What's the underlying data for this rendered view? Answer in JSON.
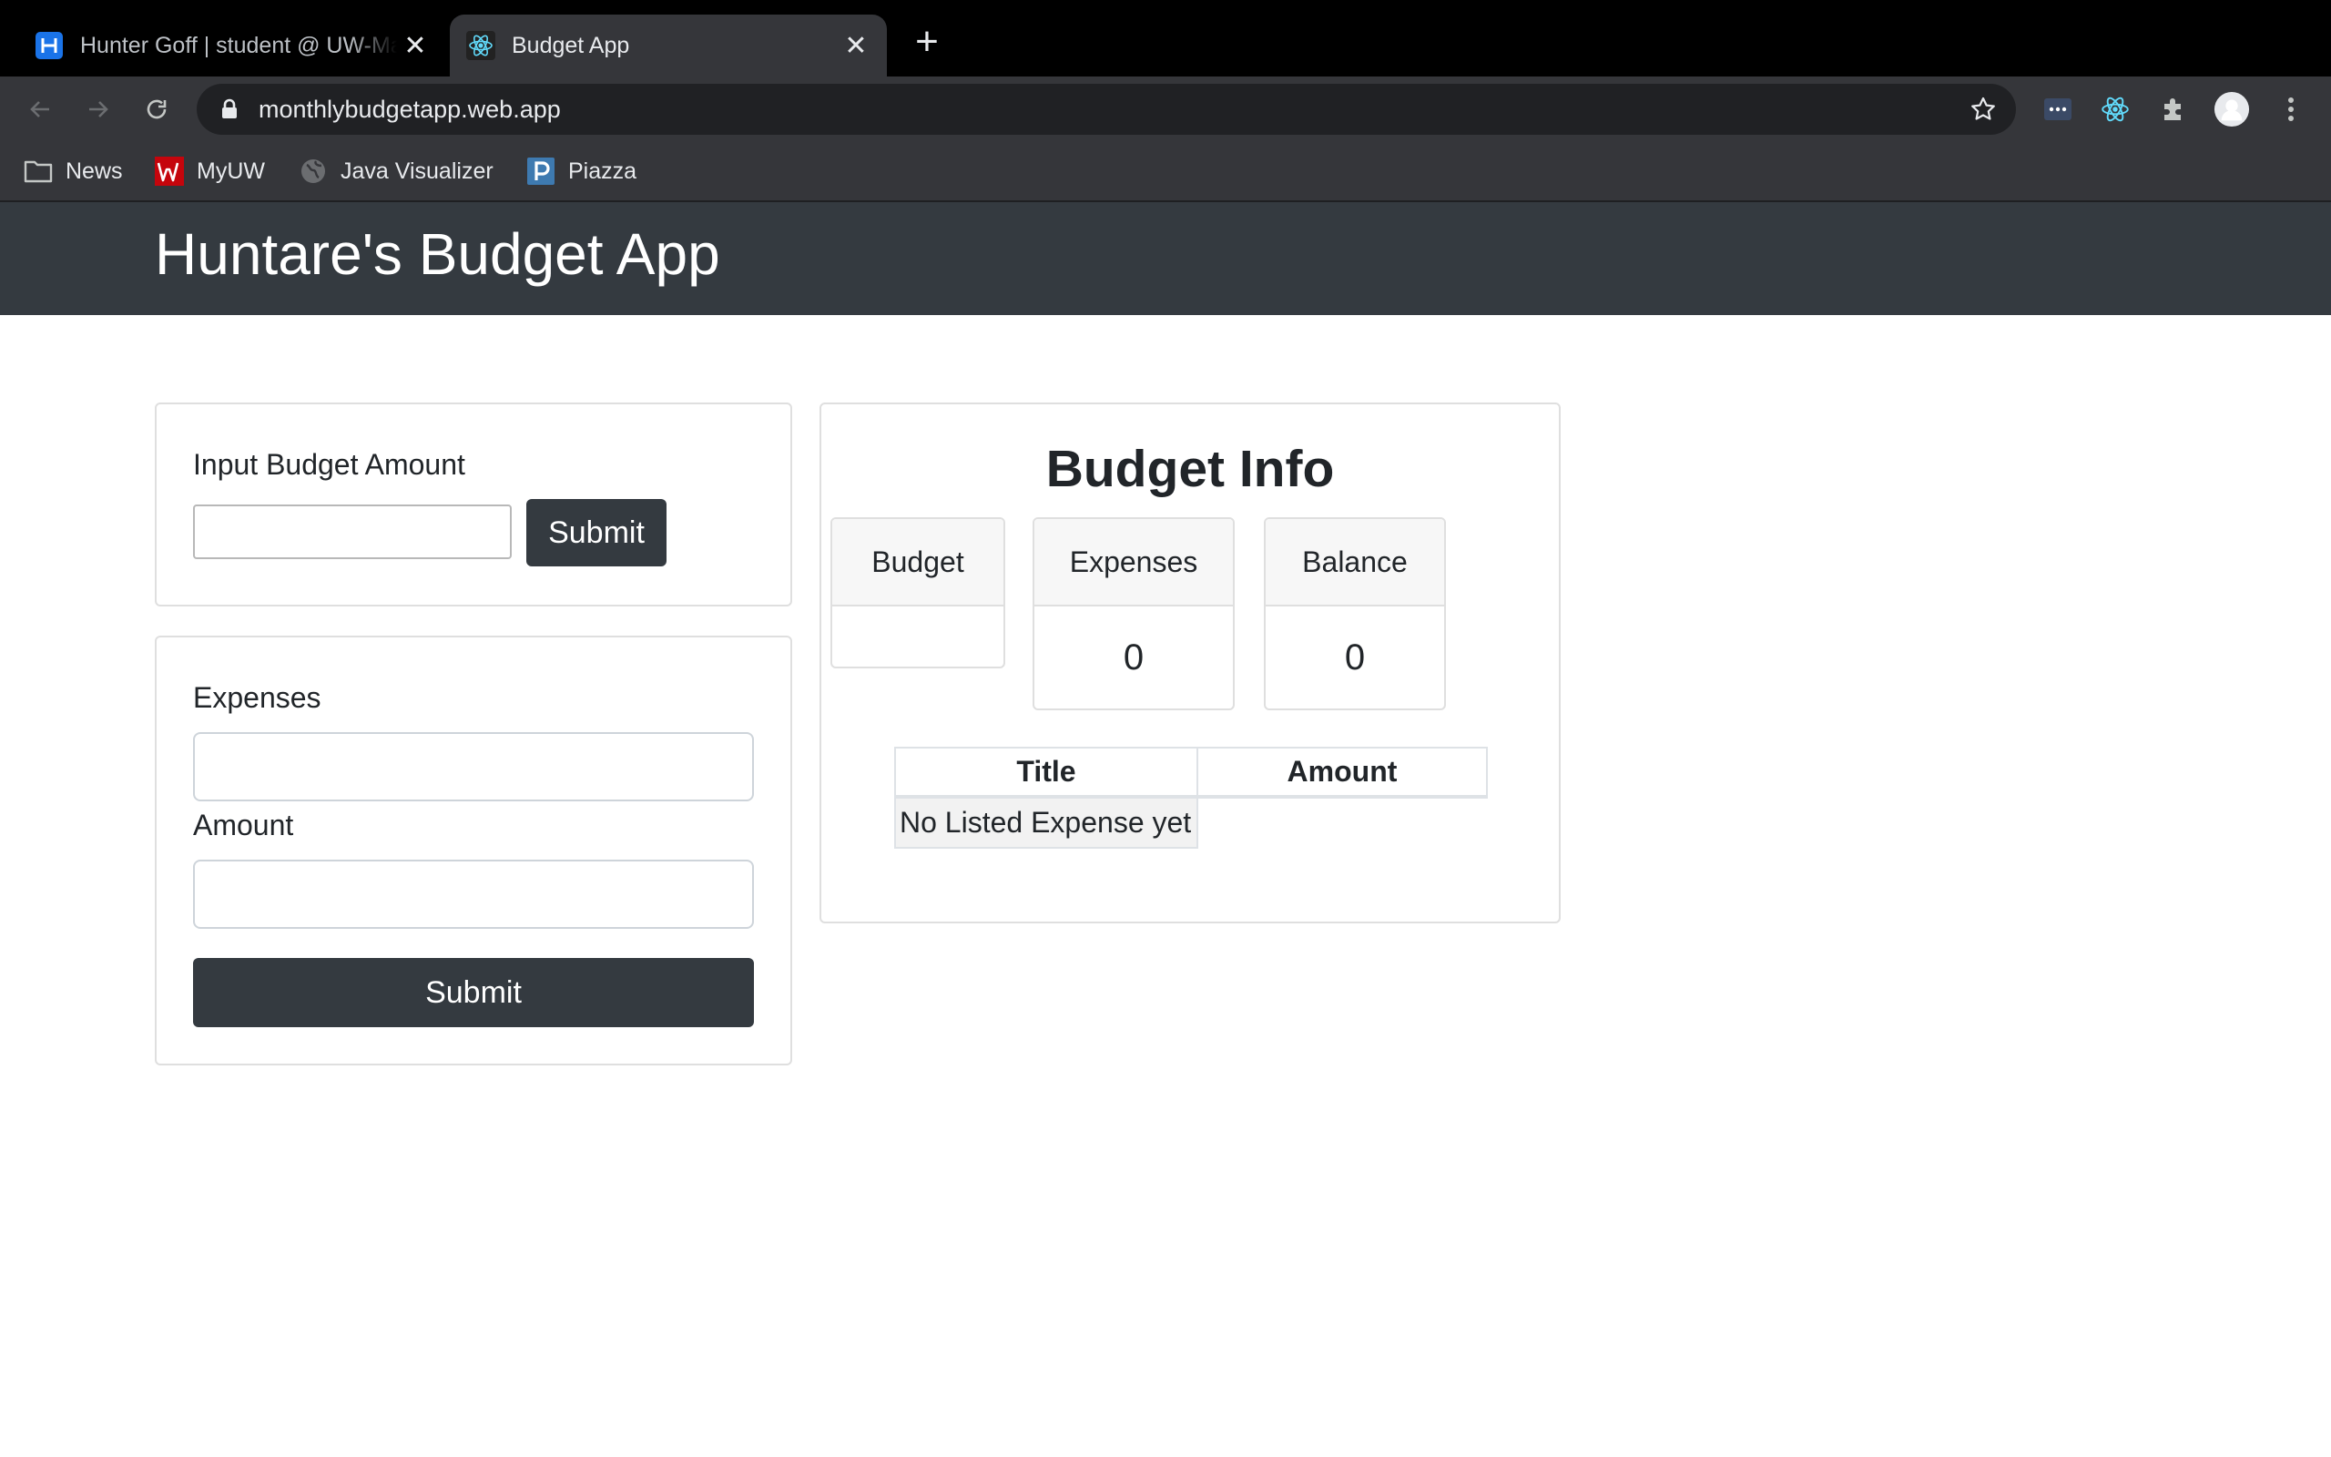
{
  "browser": {
    "tabs": [
      {
        "title": "Hunter Goff | student @ UW-Madison",
        "favicon": "handshake-icon",
        "active": false
      },
      {
        "title": "Budget App",
        "favicon": "react-icon",
        "active": true
      }
    ],
    "url": "monthlybudgetapp.web.app",
    "bookmarks": [
      {
        "label": "News",
        "icon": "folder-icon"
      },
      {
        "label": "MyUW",
        "icon": "uw-icon"
      },
      {
        "label": "Java Visualizer",
        "icon": "globe-icon"
      },
      {
        "label": "Piazza",
        "icon": "piazza-icon"
      }
    ]
  },
  "app": {
    "title": "Huntare's Budget App"
  },
  "budget_form": {
    "label": "Input Budget Amount",
    "value": "",
    "submit_label": "Submit"
  },
  "expense_form": {
    "expenses_label": "Expenses",
    "expenses_value": "",
    "amount_label": "Amount",
    "amount_value": "",
    "submit_label": "Submit"
  },
  "budget_info": {
    "title": "Budget Info",
    "budget_label": "Budget",
    "budget_value": "",
    "expenses_label": "Expenses",
    "expenses_value": "0",
    "balance_label": "Balance",
    "balance_value": "0",
    "table": {
      "columns": [
        "Title",
        "Amount"
      ],
      "empty_message": "No Listed Expense yet"
    }
  },
  "colors": {
    "header_bg": "#343a40",
    "button_bg": "#343a40",
    "card_border": "#dfdfdf"
  }
}
